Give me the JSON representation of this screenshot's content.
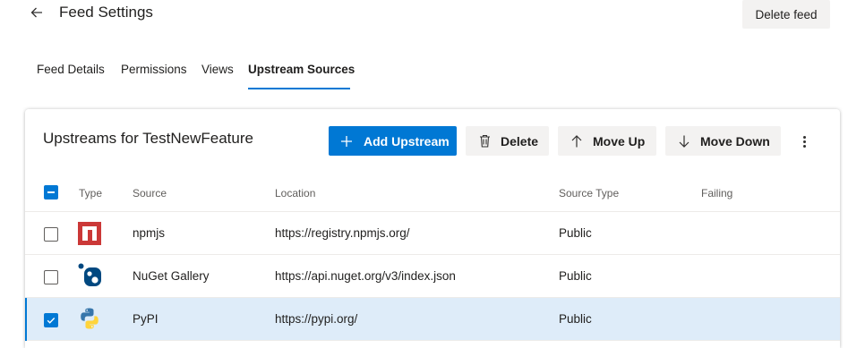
{
  "header": {
    "back_icon": "arrow-left-icon",
    "title": "Feed Settings",
    "delete_feed_label": "Delete feed"
  },
  "tabs": [
    {
      "label": "Feed Details",
      "active": false
    },
    {
      "label": "Permissions",
      "active": false
    },
    {
      "label": "Views",
      "active": false
    },
    {
      "label": "Upstream Sources",
      "active": true
    }
  ],
  "card": {
    "title": "Upstreams for TestNewFeature",
    "toolbar": {
      "add_label": "Add Upstream",
      "add_icon": "plus-icon",
      "delete_label": "Delete",
      "delete_icon": "trash-icon",
      "move_up_label": "Move Up",
      "move_up_icon": "arrow-up-icon",
      "move_down_label": "Move Down",
      "move_down_icon": "arrow-down-icon",
      "more_icon": "more-vertical-icon"
    },
    "columns": {
      "type": "Type",
      "source": "Source",
      "location": "Location",
      "source_type": "Source Type",
      "failing": "Failing"
    },
    "select_all_state": "indeterminate",
    "rows": [
      {
        "source": "npmjs",
        "location": "https://registry.npmjs.org/",
        "source_type": "Public",
        "failing": "",
        "selected": false,
        "icon": "npm-icon"
      },
      {
        "source": "NuGet Gallery",
        "location": "https://api.nuget.org/v3/index.json",
        "source_type": "Public",
        "failing": "",
        "selected": false,
        "icon": "nuget-icon"
      },
      {
        "source": "PyPI",
        "location": "https://pypi.org/",
        "source_type": "Public",
        "failing": "",
        "selected": true,
        "icon": "python-icon"
      }
    ]
  },
  "colors": {
    "accent": "#0078d4",
    "selected_row": "#deecf9",
    "npm_red": "#cb3837",
    "nuget_blue": "#004880",
    "python_blue": "#3776ab",
    "python_yellow": "#ffd43b"
  }
}
